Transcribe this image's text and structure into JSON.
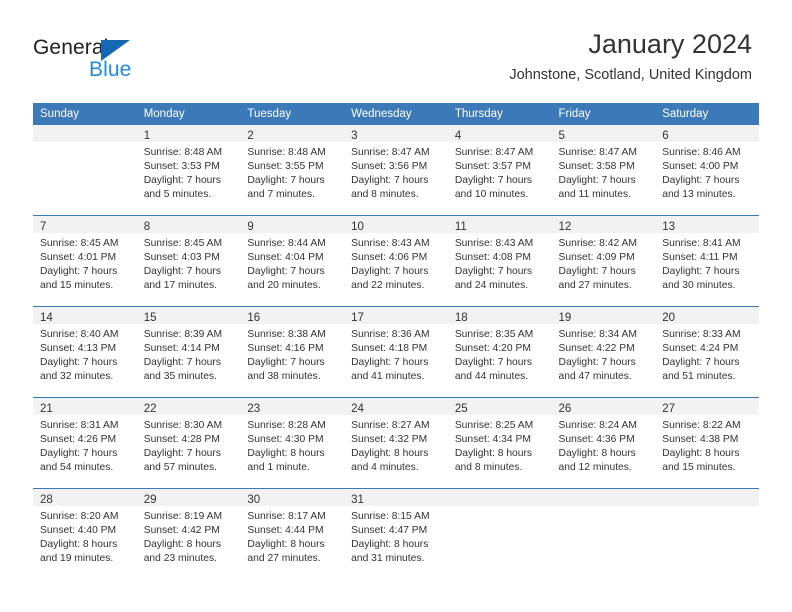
{
  "brand": {
    "name_part1": "General",
    "name_part2": "Blue",
    "triangle_color": "#1567b3",
    "blue_color": "#1f8ce0"
  },
  "header": {
    "title": "January 2024",
    "subtitle": "Johnstone, Scotland, United Kingdom",
    "header_bg": "#3b79b8",
    "daynum_bg": "#f2f2f2"
  },
  "weekdays": [
    "Sunday",
    "Monday",
    "Tuesday",
    "Wednesday",
    "Thursday",
    "Friday",
    "Saturday"
  ],
  "weeks": [
    [
      {
        "day": "",
        "lines": [
          "",
          "",
          "",
          ""
        ]
      },
      {
        "day": "1",
        "lines": [
          "Sunrise: 8:48 AM",
          "Sunset: 3:53 PM",
          "Daylight: 7 hours",
          "and 5 minutes."
        ]
      },
      {
        "day": "2",
        "lines": [
          "Sunrise: 8:48 AM",
          "Sunset: 3:55 PM",
          "Daylight: 7 hours",
          "and 7 minutes."
        ]
      },
      {
        "day": "3",
        "lines": [
          "Sunrise: 8:47 AM",
          "Sunset: 3:56 PM",
          "Daylight: 7 hours",
          "and 8 minutes."
        ]
      },
      {
        "day": "4",
        "lines": [
          "Sunrise: 8:47 AM",
          "Sunset: 3:57 PM",
          "Daylight: 7 hours",
          "and 10 minutes."
        ]
      },
      {
        "day": "5",
        "lines": [
          "Sunrise: 8:47 AM",
          "Sunset: 3:58 PM",
          "Daylight: 7 hours",
          "and 11 minutes."
        ]
      },
      {
        "day": "6",
        "lines": [
          "Sunrise: 8:46 AM",
          "Sunset: 4:00 PM",
          "Daylight: 7 hours",
          "and 13 minutes."
        ]
      }
    ],
    [
      {
        "day": "7",
        "lines": [
          "Sunrise: 8:45 AM",
          "Sunset: 4:01 PM",
          "Daylight: 7 hours",
          "and 15 minutes."
        ]
      },
      {
        "day": "8",
        "lines": [
          "Sunrise: 8:45 AM",
          "Sunset: 4:03 PM",
          "Daylight: 7 hours",
          "and 17 minutes."
        ]
      },
      {
        "day": "9",
        "lines": [
          "Sunrise: 8:44 AM",
          "Sunset: 4:04 PM",
          "Daylight: 7 hours",
          "and 20 minutes."
        ]
      },
      {
        "day": "10",
        "lines": [
          "Sunrise: 8:43 AM",
          "Sunset: 4:06 PM",
          "Daylight: 7 hours",
          "and 22 minutes."
        ]
      },
      {
        "day": "11",
        "lines": [
          "Sunrise: 8:43 AM",
          "Sunset: 4:08 PM",
          "Daylight: 7 hours",
          "and 24 minutes."
        ]
      },
      {
        "day": "12",
        "lines": [
          "Sunrise: 8:42 AM",
          "Sunset: 4:09 PM",
          "Daylight: 7 hours",
          "and 27 minutes."
        ]
      },
      {
        "day": "13",
        "lines": [
          "Sunrise: 8:41 AM",
          "Sunset: 4:11 PM",
          "Daylight: 7 hours",
          "and 30 minutes."
        ]
      }
    ],
    [
      {
        "day": "14",
        "lines": [
          "Sunrise: 8:40 AM",
          "Sunset: 4:13 PM",
          "Daylight: 7 hours",
          "and 32 minutes."
        ]
      },
      {
        "day": "15",
        "lines": [
          "Sunrise: 8:39 AM",
          "Sunset: 4:14 PM",
          "Daylight: 7 hours",
          "and 35 minutes."
        ]
      },
      {
        "day": "16",
        "lines": [
          "Sunrise: 8:38 AM",
          "Sunset: 4:16 PM",
          "Daylight: 7 hours",
          "and 38 minutes."
        ]
      },
      {
        "day": "17",
        "lines": [
          "Sunrise: 8:36 AM",
          "Sunset: 4:18 PM",
          "Daylight: 7 hours",
          "and 41 minutes."
        ]
      },
      {
        "day": "18",
        "lines": [
          "Sunrise: 8:35 AM",
          "Sunset: 4:20 PM",
          "Daylight: 7 hours",
          "and 44 minutes."
        ]
      },
      {
        "day": "19",
        "lines": [
          "Sunrise: 8:34 AM",
          "Sunset: 4:22 PM",
          "Daylight: 7 hours",
          "and 47 minutes."
        ]
      },
      {
        "day": "20",
        "lines": [
          "Sunrise: 8:33 AM",
          "Sunset: 4:24 PM",
          "Daylight: 7 hours",
          "and 51 minutes."
        ]
      }
    ],
    [
      {
        "day": "21",
        "lines": [
          "Sunrise: 8:31 AM",
          "Sunset: 4:26 PM",
          "Daylight: 7 hours",
          "and 54 minutes."
        ]
      },
      {
        "day": "22",
        "lines": [
          "Sunrise: 8:30 AM",
          "Sunset: 4:28 PM",
          "Daylight: 7 hours",
          "and 57 minutes."
        ]
      },
      {
        "day": "23",
        "lines": [
          "Sunrise: 8:28 AM",
          "Sunset: 4:30 PM",
          "Daylight: 8 hours",
          "and 1 minute."
        ]
      },
      {
        "day": "24",
        "lines": [
          "Sunrise: 8:27 AM",
          "Sunset: 4:32 PM",
          "Daylight: 8 hours",
          "and 4 minutes."
        ]
      },
      {
        "day": "25",
        "lines": [
          "Sunrise: 8:25 AM",
          "Sunset: 4:34 PM",
          "Daylight: 8 hours",
          "and 8 minutes."
        ]
      },
      {
        "day": "26",
        "lines": [
          "Sunrise: 8:24 AM",
          "Sunset: 4:36 PM",
          "Daylight: 8 hours",
          "and 12 minutes."
        ]
      },
      {
        "day": "27",
        "lines": [
          "Sunrise: 8:22 AM",
          "Sunset: 4:38 PM",
          "Daylight: 8 hours",
          "and 15 minutes."
        ]
      }
    ],
    [
      {
        "day": "28",
        "lines": [
          "Sunrise: 8:20 AM",
          "Sunset: 4:40 PM",
          "Daylight: 8 hours",
          "and 19 minutes."
        ]
      },
      {
        "day": "29",
        "lines": [
          "Sunrise: 8:19 AM",
          "Sunset: 4:42 PM",
          "Daylight: 8 hours",
          "and 23 minutes."
        ]
      },
      {
        "day": "30",
        "lines": [
          "Sunrise: 8:17 AM",
          "Sunset: 4:44 PM",
          "Daylight: 8 hours",
          "and 27 minutes."
        ]
      },
      {
        "day": "31",
        "lines": [
          "Sunrise: 8:15 AM",
          "Sunset: 4:47 PM",
          "Daylight: 8 hours",
          "and 31 minutes."
        ]
      },
      {
        "day": "",
        "lines": [
          "",
          "",
          "",
          ""
        ]
      },
      {
        "day": "",
        "lines": [
          "",
          "",
          "",
          ""
        ]
      },
      {
        "day": "",
        "lines": [
          "",
          "",
          "",
          ""
        ]
      }
    ]
  ]
}
